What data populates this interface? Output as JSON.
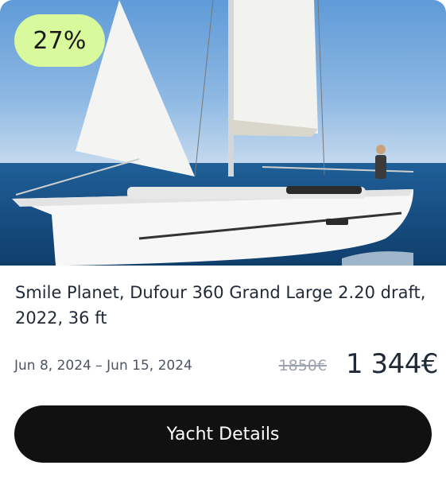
{
  "listing": {
    "discount_badge": "27%",
    "title": "Smile Planet, Dufour 360 Grand Large 2.20 draft, 2022, 36 ft",
    "dates": "Jun 8, 2024 – Jun 15, 2024",
    "old_price": "1850€",
    "new_price": "1 344€",
    "details_button": "Yacht Details"
  },
  "colors": {
    "badge_bg": "#d9f99d",
    "button_bg": "#111111",
    "text_primary": "#1f2937",
    "text_muted": "#9ca3af"
  }
}
